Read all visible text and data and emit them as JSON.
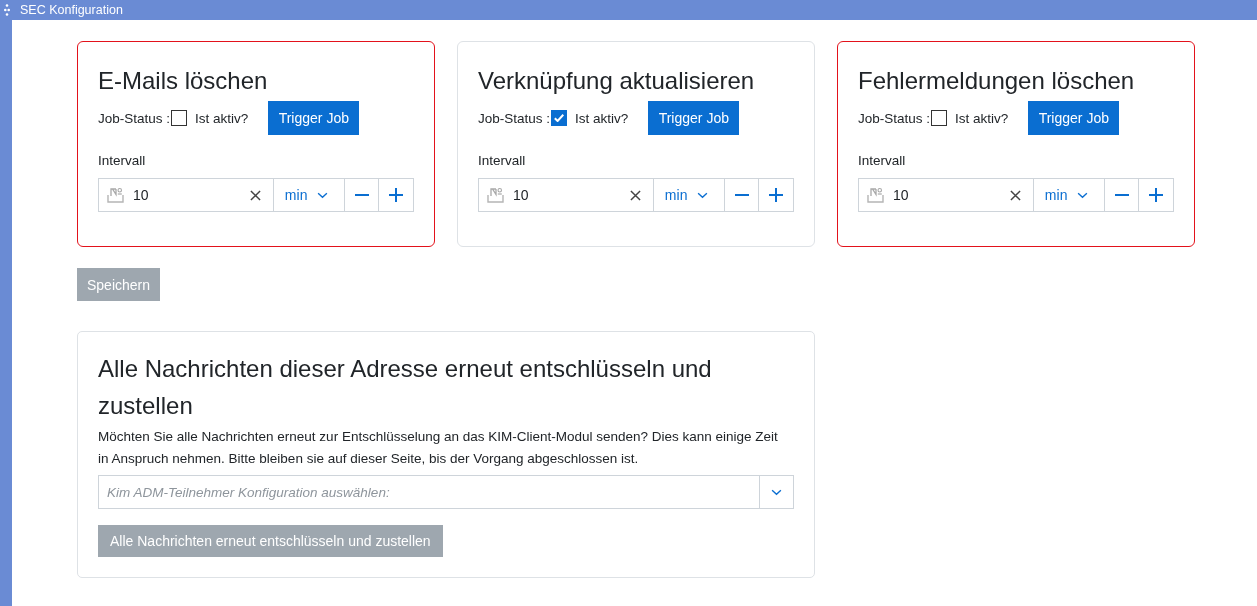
{
  "window": {
    "title": "SEC Konfiguration"
  },
  "jobs": [
    {
      "title": "E-Mails löschen",
      "status_label": "Job-Status :",
      "checked": false,
      "checkbox_label": "Ist aktiv?",
      "invalid": true,
      "trigger_button": "Trigger Job",
      "interval_label": "Intervall",
      "interval_value": "10",
      "unit": "min"
    },
    {
      "title": "Verknüpfung aktualisieren",
      "status_label": "Job-Status :",
      "checked": true,
      "checkbox_label": "Ist aktiv?",
      "invalid": false,
      "trigger_button": "Trigger Job",
      "interval_label": "Intervall",
      "interval_value": "10",
      "unit": "min"
    },
    {
      "title": "Fehlermeldungen löschen",
      "status_label": "Job-Status :",
      "checked": false,
      "checkbox_label": "Ist aktiv?",
      "invalid": true,
      "trigger_button": "Trigger Job",
      "interval_label": "Intervall",
      "interval_value": "10",
      "unit": "min"
    }
  ],
  "save_button": {
    "label": "Speichern",
    "disabled": true
  },
  "decrypt_panel": {
    "title": "Alle Nachrichten dieser Adresse erneut entschlüsseln und zustellen",
    "description": "Möchten Sie alle Nachrichten erneut zur Entschlüsselung an das KIM-Client-Modul senden? Dies kann einige Zeit in Anspruch nehmen. Bitte bleiben sie auf dieser Seite, bis der Vorgang abgeschlossen ist.",
    "select": {
      "placeholder": "Kim ADM-Teilnehmer Konfiguration auswählen:"
    },
    "button": {
      "label": "Alle Nachrichten erneut entschlüsseln und zustellen",
      "disabled": true
    }
  }
}
